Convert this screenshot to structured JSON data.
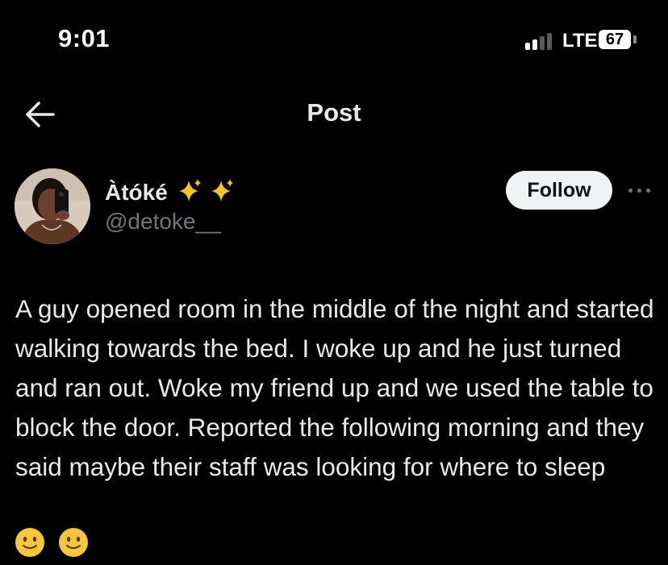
{
  "status_bar": {
    "time": "9:01",
    "network": "LTE",
    "battery": "67"
  },
  "header": {
    "title": "Post",
    "back_icon": "arrow-left-icon"
  },
  "post": {
    "author": {
      "display_name": "Àtóké",
      "name_emojis": "✨ ✨",
      "handle": "@detoke__"
    },
    "follow_label": "Follow",
    "more_icon": "ellipsis-icon",
    "text": "A guy opened room in the middle of the night and started walking towards the bed. I woke up and he just turned and ran out. Woke my friend up and we used the table to block the door. Reported the following morning and they said maybe their staff was looking for where to sleep",
    "trailing_emojis": [
      "slightly-smiling-face",
      "slightly-smiling-face"
    ]
  },
  "colors": {
    "background": "#000000",
    "primary_text": "#e7e9ea",
    "secondary_text": "#71767b",
    "follow_button_bg": "#eff3f4",
    "sparkle": "#f5c518"
  }
}
